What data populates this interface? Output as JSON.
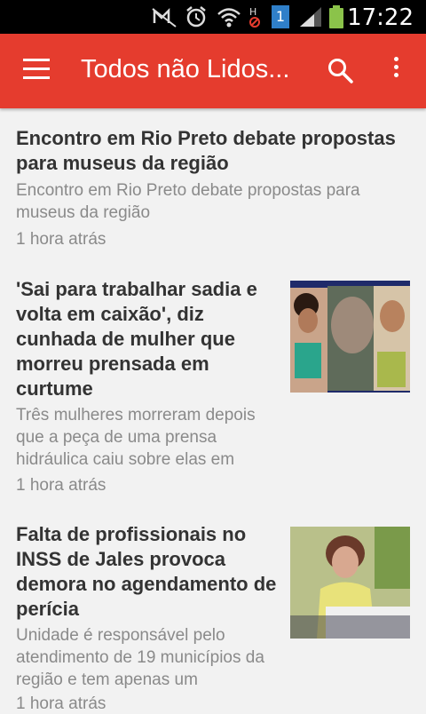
{
  "status_bar": {
    "time": "17:22",
    "sim_badge": "1",
    "icons": [
      "muted-signal-icon",
      "alarm-icon",
      "wifi-icon",
      "h-signal-icon",
      "sim-1-icon",
      "cell-signal-icon",
      "battery-icon"
    ]
  },
  "app_bar": {
    "title": "Todos não Lidos...",
    "color": "#e53c2e",
    "icons": [
      "menu-icon",
      "search-icon",
      "more-vert-icon"
    ]
  },
  "articles": [
    {
      "title": "Encontro em Rio Preto debate propostas para museus da região",
      "summary": "Encontro em Rio Preto debate propostas para museus da região",
      "time": "1 hora atrás"
    },
    {
      "title": "'Sai para trabalhar sadia e volta em caixão', diz cunhada de mulher que morreu prensada em curtume",
      "summary": "Três mulheres morreram depois que a peça de uma prensa hidráulica caiu sobre elas em",
      "time": "1 hora atrás"
    },
    {
      "title": "Falta de profissionais no INSS de Jales provoca demora no agendamento de perícia",
      "summary": "Unidade é responsável pelo atendimento de 19 municípios da região e tem apenas um",
      "time": "1 hora atrás"
    }
  ]
}
